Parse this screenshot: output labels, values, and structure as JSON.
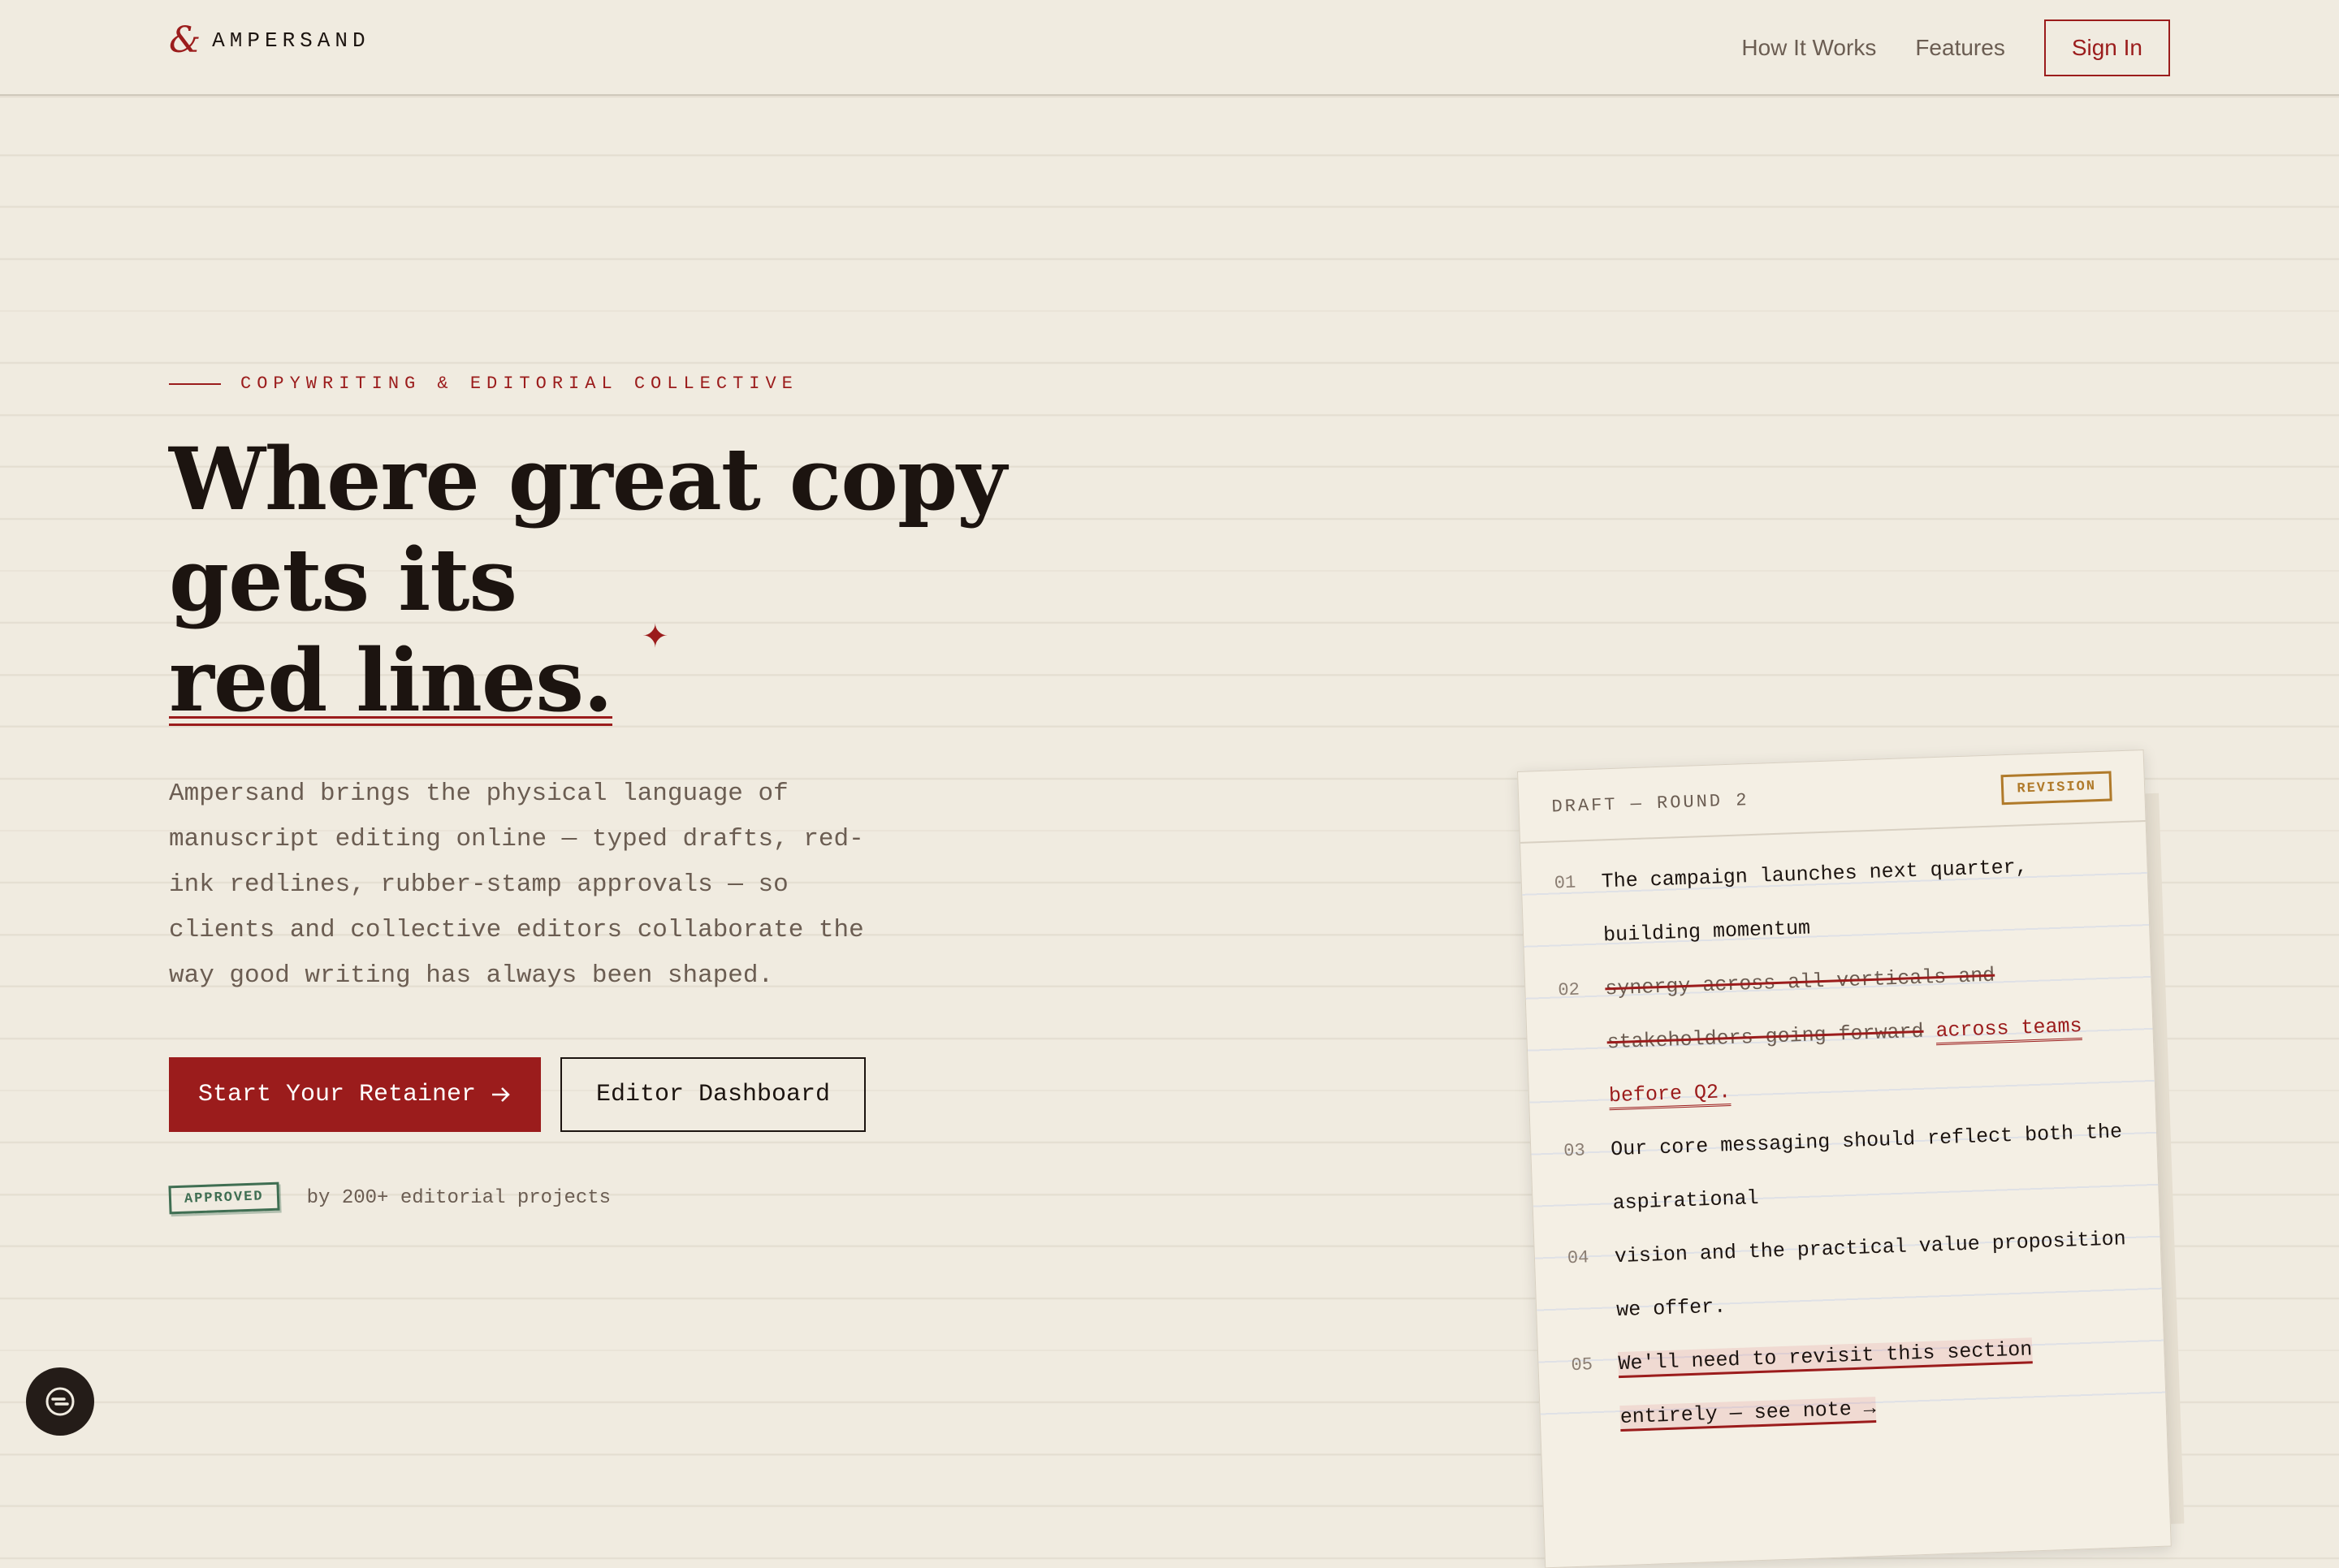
{
  "brand": {
    "mark": "&",
    "name": "AMPERSAND"
  },
  "nav": {
    "items": [
      "How It Works",
      "Features"
    ],
    "signin": "Sign In"
  },
  "hero": {
    "kicker": "COPYWRITING & EDITORIAL COLLECTIVE",
    "headline": [
      "Where great copy",
      "gets its",
      "red lines."
    ],
    "lede": "Ampersand brings the physical language of manuscript editing online — typed drafts, red-ink redlines, rubber-stamp approvals — so clients and collective editors collaborate the way good writing has always been shaped.",
    "cta_primary": "Start Your Retainer",
    "cta_secondary": "Editor Dashboard",
    "approved_stamp": "APPROVED",
    "approved_text": "by 200+ editorial projects"
  },
  "draft": {
    "title": "DRAFT — ROUND 2",
    "stamp": "REVISION",
    "lines": [
      {
        "num": "01",
        "text": "The campaign launches next quarter, building momentum"
      },
      {
        "num": "02",
        "struck": "synergy across all verticals and stakeholders going forward",
        "inserted": "across teams before Q2."
      },
      {
        "num": "03",
        "text": "Our core messaging should reflect both the aspirational"
      },
      {
        "num": "04",
        "text": "vision and the practical value proposition we offer."
      },
      {
        "num": "05",
        "highlighted": "We'll need to revisit this section entirely — see note →"
      }
    ]
  },
  "colors": {
    "accent": "#9b1c1c",
    "paper": "#f0ebe0",
    "ink": "#1c1410",
    "approved": "#3f6e52",
    "revision": "#b07a2a"
  },
  "icons": {
    "arrow": "arrow-right-icon",
    "help": "chat-help-icon",
    "sparkle": "sparkle-icon"
  }
}
